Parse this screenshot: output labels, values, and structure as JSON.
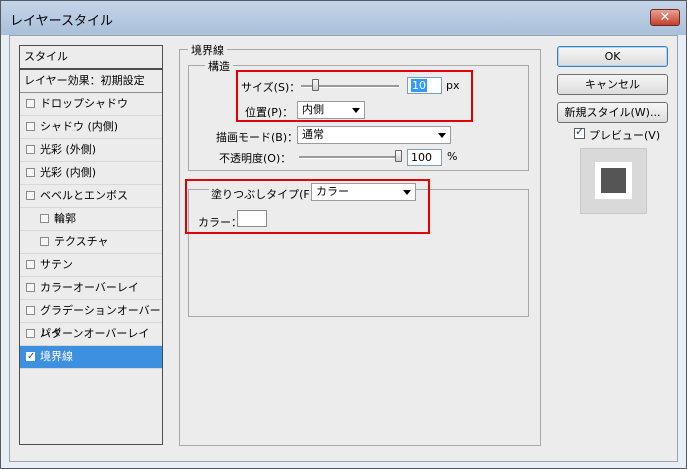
{
  "window": {
    "title": "レイヤースタイル",
    "close_label": "✕"
  },
  "style_list": {
    "header": "スタイル",
    "effects_header": "レイヤー効果：初期設定",
    "items": [
      {
        "label": "ドロップシャドウ",
        "checked": false
      },
      {
        "label": "シャドウ (内側)",
        "checked": false
      },
      {
        "label": "光彩 (外側)",
        "checked": false
      },
      {
        "label": "光彩 (内側)",
        "checked": false
      },
      {
        "label": "ベベルとエンボス",
        "checked": false
      },
      {
        "label": "輪郭",
        "checked": false,
        "sub": true
      },
      {
        "label": "テクスチャ",
        "checked": false,
        "sub": true
      },
      {
        "label": "サテン",
        "checked": false
      },
      {
        "label": "カラーオーバーレイ",
        "checked": false
      },
      {
        "label": "グラデーションオーバーレイ",
        "checked": false
      },
      {
        "label": "パターンオーバーレイ",
        "checked": false
      },
      {
        "label": "境界線",
        "checked": true,
        "selected": true
      }
    ]
  },
  "stroke": {
    "title": "境界線",
    "structure": {
      "title": "構造",
      "size_label": "サイズ(S)：",
      "size_value": "10",
      "size_unit": "px",
      "size_level": 0.05,
      "position_label": "位置(P)：",
      "position_value": "内側",
      "blend_label": "描画モード(B)：",
      "blend_value": "通常",
      "opacity_label": "不透明度(O)：",
      "opacity_value": "100",
      "opacity_unit": "%",
      "opacity_level": 1.0
    },
    "fill": {
      "type_label": "塗りつぶしタイプ(F)：",
      "type_value": "カラー",
      "color_label": "カラー：",
      "color_value": "#ffffff"
    }
  },
  "buttons": {
    "ok": "OK",
    "cancel": "キャンセル",
    "new_style": "新規スタイル(W)...",
    "preview_label": "プレビュー(V)",
    "preview_checked": true
  },
  "colors": {
    "highlight": "#e10000",
    "selection": "#3d8fe0",
    "preview_fill": "#555555"
  }
}
